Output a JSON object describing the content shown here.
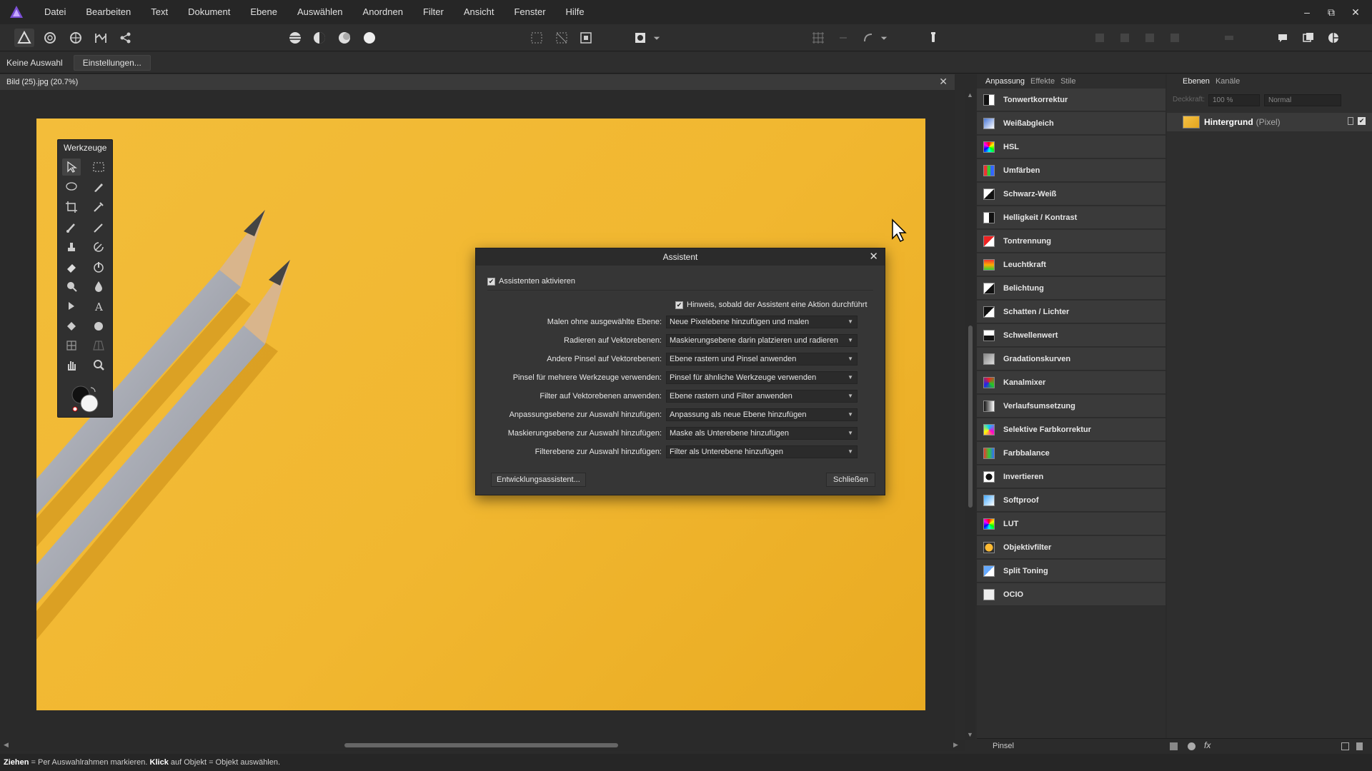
{
  "menu": [
    "Datei",
    "Bearbeiten",
    "Text",
    "Dokument",
    "Ebene",
    "Auswählen",
    "Anordnen",
    "Filter",
    "Ansicht",
    "Fenster",
    "Hilfe"
  ],
  "window_controls": [
    "–",
    "⧉",
    "✕"
  ],
  "context": {
    "selection": "Keine Auswahl",
    "settings_button": "Einstellungen..."
  },
  "document": {
    "title": "Bild (25).jpg (20.7%)",
    "close": "✕"
  },
  "tools": {
    "title": "Werkzeuge"
  },
  "dialog": {
    "title": "Assistent",
    "close": "✕",
    "enable_label": "Assistenten aktivieren",
    "enable_checked": true,
    "hint_label": "Hinweis, sobald der Assistent eine Aktion durchführt",
    "hint_checked": true,
    "options": [
      {
        "label": "Malen ohne ausgewählte Ebene:",
        "value": "Neue Pixelebene hinzufügen und malen"
      },
      {
        "label": "Radieren auf Vektorebenen:",
        "value": "Maskierungsebene darin platzieren und radieren"
      },
      {
        "label": "Andere Pinsel auf Vektorebenen:",
        "value": "Ebene rastern und Pinsel anwenden"
      },
      {
        "label": "Pinsel für mehrere Werkzeuge verwenden:",
        "value": "Pinsel für ähnliche Werkzeuge verwenden"
      },
      {
        "label": "Filter auf Vektorebenen anwenden:",
        "value": "Ebene rastern und Filter anwenden"
      },
      {
        "label": "Anpassungsebene zur Auswahl hinzufügen:",
        "value": "Anpassung als neue Ebene hinzufügen"
      },
      {
        "label": "Maskierungsebene zur Auswahl hinzufügen:",
        "value": "Maske als Unterebene hinzufügen"
      },
      {
        "label": "Filterebene zur Auswahl hinzufügen:",
        "value": "Filter als Unterebene hinzufügen"
      }
    ],
    "dev_button": "Entwicklungsassistent...",
    "close_button": "Schließen"
  },
  "adjustments": {
    "tabs": [
      "Anpassung",
      "Effekte",
      "Stile"
    ],
    "items": [
      {
        "label": "Tonwertkorrektur",
        "icon": "levels-icon"
      },
      {
        "label": "Weißabgleich",
        "icon": "white-balance-icon"
      },
      {
        "label": "HSL",
        "icon": "hsl-icon"
      },
      {
        "label": "Umfärben",
        "icon": "recolor-icon"
      },
      {
        "label": "Schwarz-Weiß",
        "icon": "black-white-icon"
      },
      {
        "label": "Helligkeit / Kontrast",
        "icon": "brightness-contrast-icon"
      },
      {
        "label": "Tontrennung",
        "icon": "posterize-icon"
      },
      {
        "label": "Leuchtkraft",
        "icon": "vibrance-icon"
      },
      {
        "label": "Belichtung",
        "icon": "exposure-icon"
      },
      {
        "label": "Schatten / Lichter",
        "icon": "shadows-highlights-icon"
      },
      {
        "label": "Schwellenwert",
        "icon": "threshold-icon"
      },
      {
        "label": "Gradationskurven",
        "icon": "curves-icon"
      },
      {
        "label": "Kanalmixer",
        "icon": "channel-mixer-icon"
      },
      {
        "label": "Verlaufsumsetzung",
        "icon": "gradient-map-icon"
      },
      {
        "label": "Selektive Farbkorrektur",
        "icon": "selective-color-icon"
      },
      {
        "label": "Farbbalance",
        "icon": "color-balance-icon"
      },
      {
        "label": "Invertieren",
        "icon": "invert-icon"
      },
      {
        "label": "Softproof",
        "icon": "soft-proof-icon"
      },
      {
        "label": "LUT",
        "icon": "lut-icon"
      },
      {
        "label": "Objektivfilter",
        "icon": "lens-filter-icon"
      },
      {
        "label": "Split Toning",
        "icon": "split-toning-icon"
      },
      {
        "label": "OCIO",
        "icon": "ocio-icon"
      }
    ]
  },
  "layers": {
    "tabs": [
      "Ebenen",
      "Kanäle"
    ],
    "opacity_label": "Deckkraft:",
    "opacity_value": "100 %",
    "blend_mode": "Normal",
    "layer_name": "Hintergrund",
    "layer_type": "(Pixel)"
  },
  "bottom_panel": {
    "label": "Pinsel"
  },
  "status": {
    "bold1": "Ziehen",
    "text1": " = Per Auswahlrahmen markieren. ",
    "bold2": "Klick",
    "text2": " auf Objekt = Objekt auswählen."
  },
  "colors": {
    "accent": "#7b4fd6",
    "photo_bg": "#f1b730",
    "panel": "#2e2e2e"
  }
}
